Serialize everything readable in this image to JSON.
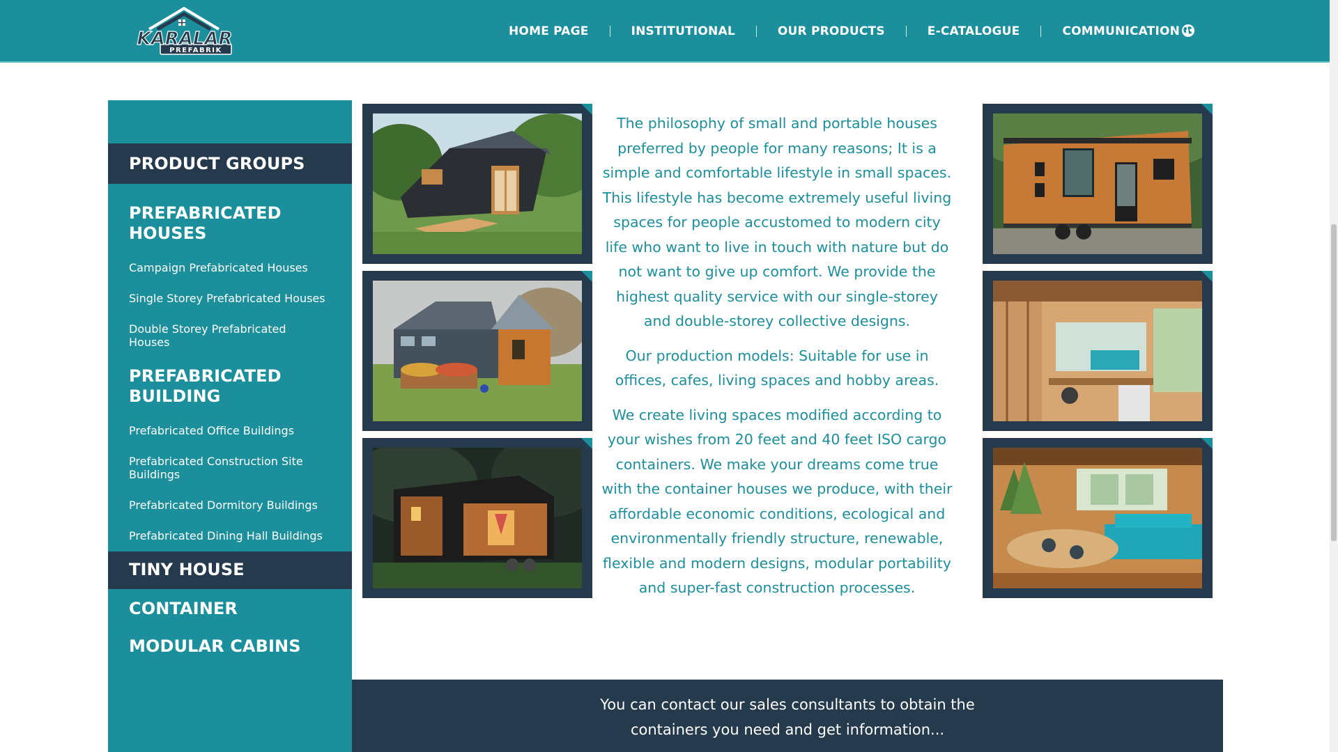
{
  "brand": {
    "logo_text": "KARALAR",
    "logo_subtext": "PREFABRIK"
  },
  "nav": {
    "items": [
      {
        "label": "HOME PAGE"
      },
      {
        "label": "INSTITUTIONAL"
      },
      {
        "label": "OUR PRODUCTS"
      },
      {
        "label": "E-CATALOGUE"
      },
      {
        "label": "COMMUNICATION"
      }
    ],
    "language_icon": "globe-icon"
  },
  "sidebar": {
    "title": "PRODUCT GROUPS",
    "group_prefab_houses": "PREFABRICATED HOUSES",
    "prefab_houses_items": [
      "Campaign Prefabricated Houses",
      "Single Storey Prefabricated Houses",
      "Double Storey Prefabricated Houses"
    ],
    "group_prefab_building": "PREFABRICATED BUILDING",
    "prefab_building_items": [
      "Prefabricated Office Buildings",
      "Prefabricated Construction Site Buildings",
      "Prefabricated Dormitory Buildings",
      "Prefabricated Dining Hall Buildings"
    ],
    "tiny_house": "TINY HOUSE",
    "container": "CONTAINER",
    "modular_cabins": "MODULAR CABINS"
  },
  "content": {
    "paragraph_1": "The philosophy of small and portable houses preferred by people for many reasons; It is a simple and comfortable lifestyle in small spaces. This lifestyle has become extremely useful living spaces for people accustomed to modern city life who want to live in touch with nature but do not want to give up comfort. We provide the highest quality service with our single-storey and double-storey collective designs.",
    "paragraph_2": "Our production models: Suitable for use in offices, cafes, living spaces and hobby areas.",
    "paragraph_3": "We create living spaces modified according to your wishes from 20 feet and 40 feet ISO cargo containers. We make your dreams come true with the container houses we produce, with their affordable economic conditions, ecological and environmentally friendly structure, renewable, flexible and modern designs, modular portability and super-fast construction processes."
  },
  "contact": {
    "text": "You can contact our sales consultants to obtain the containers you need and get information..."
  },
  "colors": {
    "teal": "#1b8f9c",
    "navy": "#253a4c",
    "white": "#ffffff"
  }
}
